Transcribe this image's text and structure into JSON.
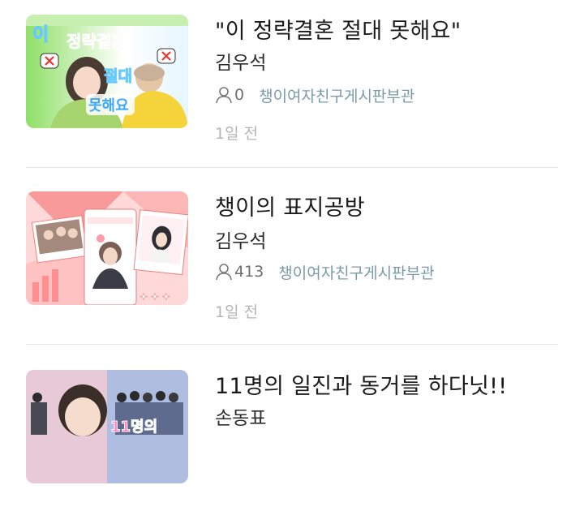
{
  "posts": [
    {
      "title": "\"이 정략결혼 절대 못해요\"",
      "author": "김우석",
      "view_count": "0",
      "board": "챙이여자친구게시판부관",
      "time": "1일 전",
      "thumbnail_icon": "wedding-cover-thumbnail",
      "accent": "#7ed957"
    },
    {
      "title": "챙이의 표지공방",
      "author": "김우석",
      "view_count": "413",
      "board": "챙이여자친구게시판부관",
      "time": "1일 전",
      "thumbnail_icon": "cover-workshop-thumbnail",
      "accent": "#f58b8b"
    },
    {
      "title": "11명의 일진과 동거를 하다닛!!",
      "author": "손동표",
      "thumbnail_icon": "group-photo-thumbnail",
      "accent": "#9fb6e6"
    }
  ],
  "icons": {
    "views": "person-icon"
  },
  "colors": {
    "title": "#1b1b1b",
    "board_link": "#7a9aa8",
    "timestamp": "#b5b5b5",
    "divider": "#e4e4e4"
  }
}
